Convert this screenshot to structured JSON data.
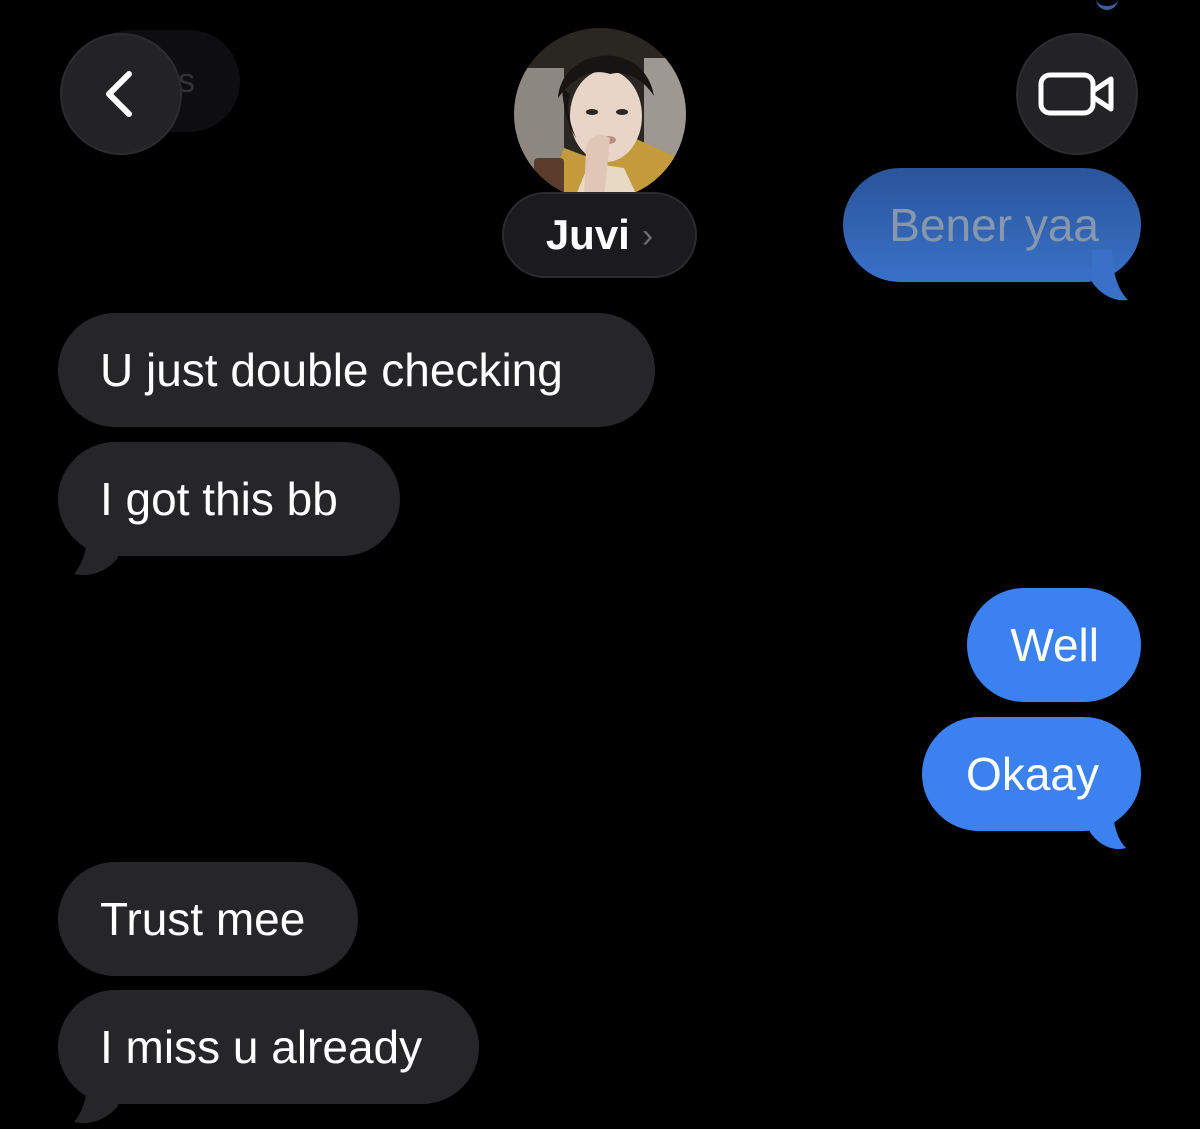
{
  "header": {
    "back_icon": "chevron-left-icon",
    "ghost_label": "s",
    "contact_name": "Juvi",
    "contact_chevron": "›",
    "video_icon": "video-camera-icon"
  },
  "colors": {
    "background": "#000000",
    "incoming_bubble": "#262628",
    "outgoing_bubble": "#3b82f0",
    "header_button": "#232326"
  },
  "messages": [
    {
      "id": "m1",
      "direction": "outgoing",
      "text": "Bener yaa",
      "tail": true
    },
    {
      "id": "m2",
      "direction": "incoming",
      "text": "U just double checking",
      "tail": false
    },
    {
      "id": "m3",
      "direction": "incoming",
      "text": "I got this bb",
      "tail": true
    },
    {
      "id": "m4",
      "direction": "outgoing",
      "text": "Well",
      "tail": false
    },
    {
      "id": "m5",
      "direction": "outgoing",
      "text": "Okaay",
      "tail": true
    },
    {
      "id": "m6",
      "direction": "incoming",
      "text": "Trust mee",
      "tail": false
    },
    {
      "id": "m7",
      "direction": "incoming",
      "text": "I miss u already",
      "tail": true
    }
  ]
}
